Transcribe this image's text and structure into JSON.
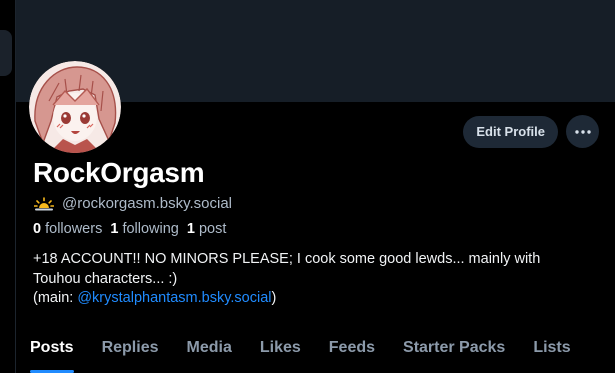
{
  "profile": {
    "display_name": "RockOrgasm",
    "handle": "@rockorgasm.bsky.social",
    "handle_icon": "sun-horizon-icon",
    "stats": {
      "followers_count": "0",
      "followers_label": "followers",
      "following_count": "1",
      "following_label": "following",
      "posts_count": "1",
      "posts_label": "post"
    },
    "bio": {
      "line1": "+18 ACCOUNT!! NO MINORS PLEASE; I cook some good lewds... mainly with",
      "line2": "Touhou characters... :)",
      "line3_prefix": "(main: ",
      "line3_link": "@krystalphantasm.bsky.social",
      "line3_suffix": ")"
    }
  },
  "actions": {
    "edit_label": "Edit Profile",
    "more_icon": "ellipsis-icon"
  },
  "tabs": [
    {
      "label": "Posts",
      "active": true
    },
    {
      "label": "Replies",
      "active": false
    },
    {
      "label": "Media",
      "active": false
    },
    {
      "label": "Likes",
      "active": false
    },
    {
      "label": "Feeds",
      "active": false
    },
    {
      "label": "Starter Packs",
      "active": false
    },
    {
      "label": "Lists",
      "active": false
    }
  ],
  "colors": {
    "background": "#000000",
    "banner": "#161e27",
    "button_bg": "#1e2936",
    "accent": "#208bfe",
    "muted_text": "#aebbc9",
    "tab_inactive": "#8c9aaa"
  }
}
